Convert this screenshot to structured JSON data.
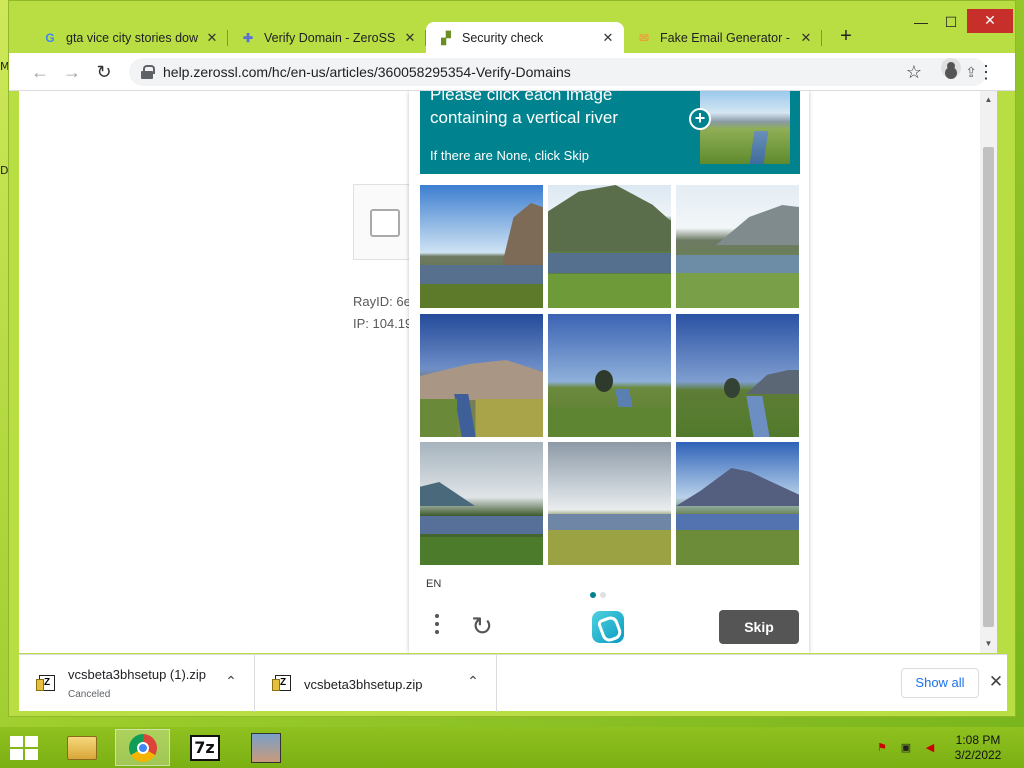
{
  "desktop": {
    "edge_letter_1": "M",
    "edge_letter_2": "D"
  },
  "browser": {
    "tabs": [
      {
        "title": "gta vice city stories down",
        "icon": "google-g-icon",
        "close": "✕"
      },
      {
        "title": "Verify Domain - ZeroSSL",
        "icon": "puzzle-icon",
        "close": "✕"
      },
      {
        "title": "Security check",
        "icon": "zendesk-icon",
        "close": "✕",
        "active": true
      },
      {
        "title": "Fake Email Generator - te",
        "icon": "envelope-icon",
        "close": "✕"
      }
    ],
    "new_tab": "+",
    "window_controls": {
      "minimize": "—",
      "maximize": "☐",
      "close": "✕"
    },
    "nav": {
      "back": "←",
      "forward": "→",
      "reload": "↻"
    },
    "url": "help.zerossl.com/hc/en-us/articles/360058295354-Verify-Domains",
    "omnibox_icons": {
      "share": "⇪",
      "bookmark": "☆",
      "menu": "⋮"
    }
  },
  "page": {
    "ray_id": "RayID: 6e",
    "ip": "IP: 104.19"
  },
  "captcha": {
    "prompt": "Please click each image containing a vertical river",
    "subtext": "If there are None, click Skip",
    "plus": "+",
    "language": "EN",
    "refresh": "↻",
    "skip_label": "Skip",
    "pages": 2,
    "current_page": 1,
    "accent_color": "#00838f"
  },
  "downloads": [
    {
      "filename": "vcsbeta3bhsetup (1).zip",
      "status": "Canceled",
      "chevron": "⌃"
    },
    {
      "filename": "vcsbeta3bhsetup.zip",
      "status": "",
      "chevron": "⌃"
    }
  ],
  "shelf": {
    "show_all": "Show all",
    "close": "✕"
  },
  "taskbar": {
    "apps": [
      "file-explorer-icon",
      "chrome-icon",
      "7zip-icon",
      "game-icon"
    ],
    "sevenzip_label": "7z",
    "time": "1:08 PM",
    "date": "3/2/2022"
  }
}
